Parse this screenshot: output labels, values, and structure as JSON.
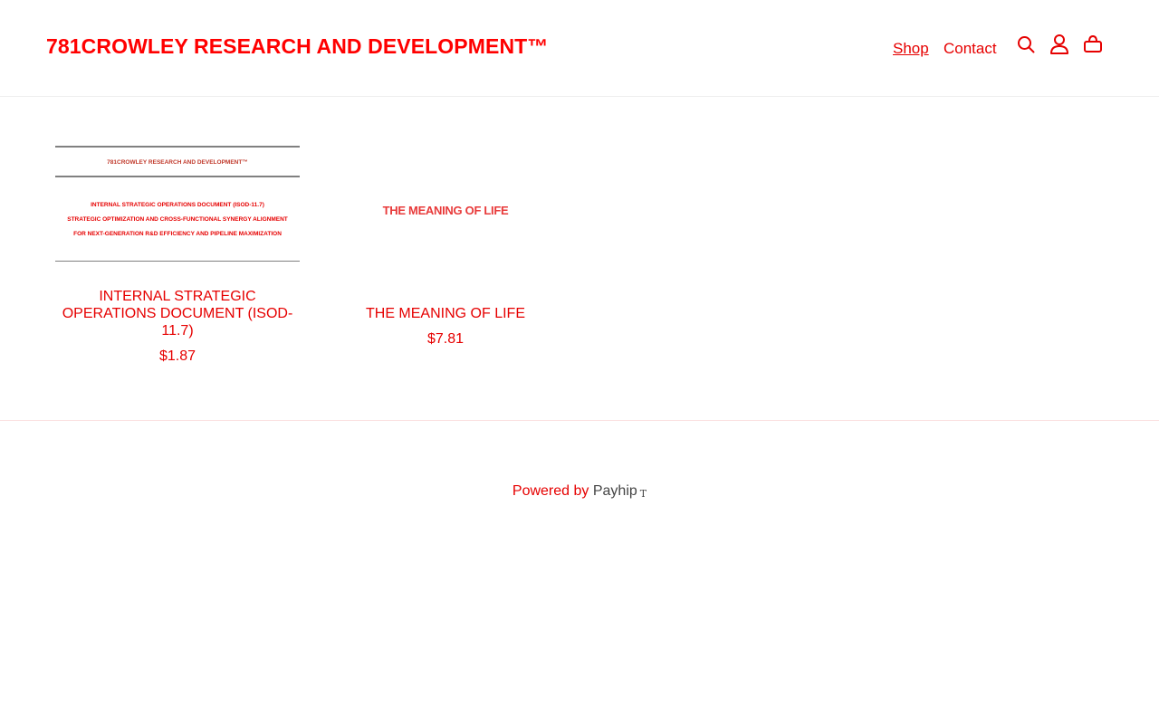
{
  "header": {
    "brand": "781CROWLEY RESEARCH AND DEVELOPMENT™",
    "nav": [
      {
        "label": "Shop",
        "active": true
      },
      {
        "label": "Contact",
        "active": false
      }
    ],
    "icons": [
      "search-icon",
      "account-icon",
      "cart-icon"
    ]
  },
  "products": [
    {
      "title": "INTERNAL STRATEGIC OPERATIONS DOCUMENT (ISOD-11.7)",
      "title_lines": [
        "INTERNAL STRATEGIC",
        "OPERATIONS DOCUMENT (ISOD-",
        "11.7)"
      ],
      "price": "$1.87",
      "thumbnail": {
        "heading": "781CROWLEY RESEARCH AND DEVELOPMENT™",
        "lines": [
          "INTERNAL STRATEGIC OPERATIONS DOCUMENT (ISOD-11.7)",
          "STRATEGIC OPTIMIZATION AND CROSS-FUNCTIONAL SYNERGY ALIGNMENT",
          "FOR NEXT-GENERATION R&D EFFICIENCY AND PIPELINE MAXIMIZATION"
        ]
      }
    },
    {
      "title": "THE MEANING OF LIFE",
      "price": "$7.81",
      "thumbnail": {
        "heading": "THE MEANING OF LIFE"
      }
    }
  ],
  "footer": {
    "powered_by": "Powered by",
    "platform": "Payhip",
    "platform_mark": "T"
  },
  "colors": {
    "accent": "#e60000",
    "brand": "#ff0000",
    "divider": "#eeeeee",
    "footer_text": "#444444"
  }
}
